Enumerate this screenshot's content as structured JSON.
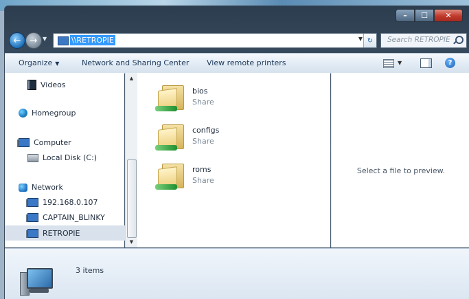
{
  "window": {
    "caption_min": "–",
    "caption_max": "☐",
    "caption_close": "✕"
  },
  "address": {
    "path": "\\\\RETROPIE",
    "back_glyph": "←",
    "forward_glyph": "→",
    "refresh_glyph": "↻",
    "dropdown_glyph": "▼"
  },
  "search": {
    "placeholder": "Search RETROPIE"
  },
  "toolbar": {
    "organize": "Organize",
    "network_sharing": "Network and Sharing Center",
    "view_printers": "View remote printers",
    "help_glyph": "?",
    "arrow_glyph": "▼"
  },
  "nav": {
    "videos": "Videos",
    "homegroup": "Homegroup",
    "computer": "Computer",
    "local_disk": "Local Disk (C:)",
    "network": "Network",
    "host1": "192.168.0.107",
    "host2": "CAPTAIN_BLINKY",
    "host3": "RETROPIE",
    "scroll_up": "▲",
    "scroll_down": "▼"
  },
  "files": [
    {
      "name": "bios",
      "type": "Share"
    },
    {
      "name": "configs",
      "type": "Share"
    },
    {
      "name": "roms",
      "type": "Share"
    }
  ],
  "preview": {
    "message": "Select a file to preview."
  },
  "details": {
    "count": "3 items"
  },
  "colors": {
    "selection": "#3399ff",
    "nav_selected": "#d9e2ec",
    "close_button": "#c0392b"
  }
}
